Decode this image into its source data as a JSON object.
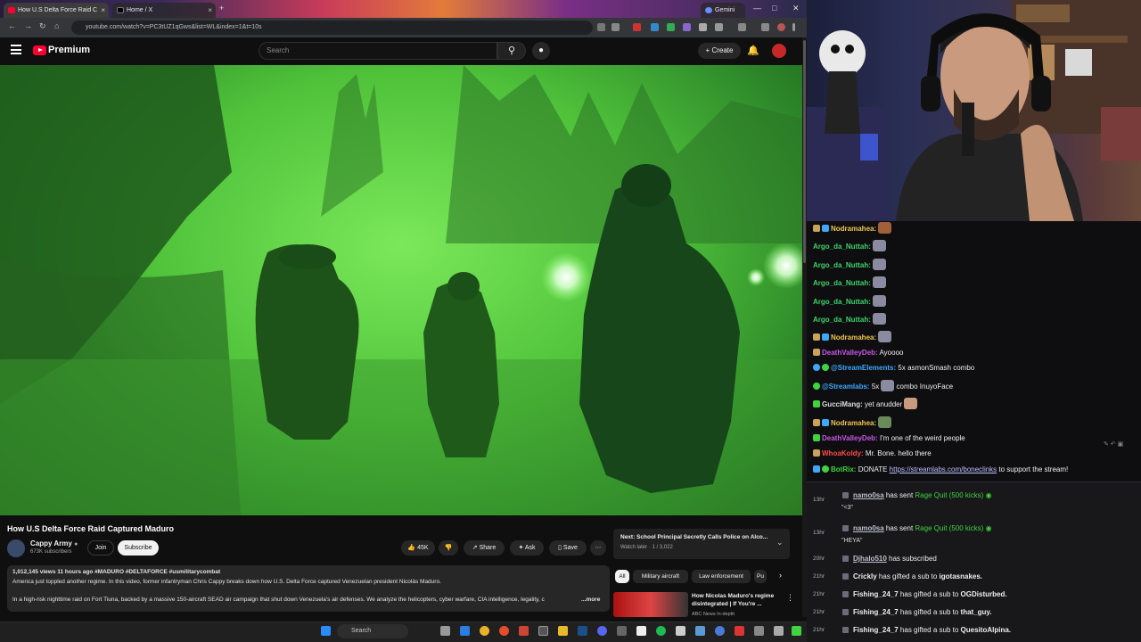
{
  "browser": {
    "tabs": [
      {
        "label": "How U.S Delta Force Raid C"
      },
      {
        "label": "Home / X"
      },
      {
        "label": "Gemini"
      }
    ],
    "url": "youtube.com/watch?v=PC3tUZ1qGws&list=WL&index=1&t=10s"
  },
  "youtube": {
    "brand": "Premium",
    "search_placeholder": "Search",
    "create_label": "Create",
    "video_title": "How U.S Delta Force Raid Captured Maduro",
    "channel_name": "Cappy Army",
    "subscribers": "673K subscribers",
    "join_label": "Join",
    "subscribe_label": "Subscribe",
    "likes": "45K",
    "share_label": "Share",
    "ask_label": "Ask",
    "save_label": "Save",
    "desc_meta": "1,012,145 views  11 hours ago  #MADURO #DELTAFORCE #usmilitarycombat",
    "desc_line1": "America just toppled another regime. In this video, former infantryman Chris Cappy breaks down how U.S. Delta Force captured Venezuelan president Nicolás Maduro.",
    "desc_line2": "In a high-risk nighttime raid on Fort Tiuna, backed by a massive 150-aircraft SEAD air campaign that shut down Venezuela's air defenses. We analyze the helicopters, cyber warfare, CIA intelligence, legality, c",
    "desc_more": "...more",
    "next_title": "Next: School Principal Secretly Calls Police on Alco...",
    "next_sub": "Watch later · 1 / 3,022",
    "chips": [
      "All",
      "Military aircraft",
      "Law enforcement",
      "Pu"
    ],
    "rec_title": "How Nicolas Maduro's regime disintegrated | If You're ...",
    "rec_channel": "ABC News In-depth"
  },
  "chat": [
    {
      "user": "Nodramahea:",
      "msg": "",
      "color": "#f0c850"
    },
    {
      "user": "Argo_da_Nuttah:",
      "msg": "",
      "color": "#3fd36a"
    },
    {
      "user": "Argo_da_Nuttah:",
      "msg": "",
      "color": "#3fd36a"
    },
    {
      "user": "Argo_da_Nuttah:",
      "msg": "",
      "color": "#3fd36a"
    },
    {
      "user": "Argo_da_Nuttah:",
      "msg": "",
      "color": "#3fd36a"
    },
    {
      "user": "Argo_da_Nuttah:",
      "msg": "",
      "color": "#3fd36a"
    },
    {
      "user": "Nodramahea:",
      "msg": "",
      "color": "#f0c850"
    },
    {
      "user": "DeathValleyDeb:",
      "msg": "Ayoooo",
      "color": "#c857e8"
    },
    {
      "user": "@StreamElements:",
      "msg": "5x asmonSmash combo",
      "color": "#3ea8ff"
    },
    {
      "user": "@Streamlabs:",
      "msg": "5x",
      "msg2": "combo InuyoFace",
      "color": "#3ea8ff"
    },
    {
      "user": "GucciMang:",
      "msg": "yet anudder",
      "color": "#dddddd"
    },
    {
      "user": "Nodramahea:",
      "msg": "",
      "color": "#f0c850"
    },
    {
      "user": "DeathValleyDeb:",
      "msg": "I'm one of the weird people",
      "color": "#c857e8"
    },
    {
      "user": "WhoaKoldy:",
      "msg": "Mr. Bone. hello there",
      "color": "#ff4a4a"
    },
    {
      "user": "BotRix:",
      "msg": "DONATE",
      "link": "https://streamlabs.com/boneclinks",
      "msg2": "to support the stream!",
      "color": "#3fd33f"
    }
  ],
  "events": [
    {
      "time": "13hr",
      "name": "namo0sa",
      "action": "has sent",
      "item": "Rage Quit (500 kicks)",
      "quote": "\"<3\""
    },
    {
      "time": "13hr",
      "name": "namo0sa",
      "action": "has sent",
      "item": "Rage Quit (500 kicks)",
      "quote": "\"HEYA\""
    },
    {
      "time": "20hr",
      "name": "Djhalo510",
      "action": "has subscribed"
    },
    {
      "time": "21hr",
      "name": "Crickly",
      "action": "has gifted a sub to",
      "target": "igotasnakes."
    },
    {
      "time": "21hr",
      "name": "Fishing_24_7",
      "action": "has gifted a sub to",
      "target": "OGDisturbed."
    },
    {
      "time": "21hr",
      "name": "Fishing_24_7",
      "action": "has gifted a sub to",
      "target": "that_guy."
    },
    {
      "time": "21hr",
      "name": "Fishing_24_7",
      "action": "has gifted a sub to",
      "target": "QuesitoAlpina."
    }
  ],
  "taskbar": {
    "search_label": "Search"
  },
  "colors": {
    "yt_red": "#ff0033",
    "nightvision_green": "#5fd34a",
    "chat_bg": "#0e0e10"
  }
}
